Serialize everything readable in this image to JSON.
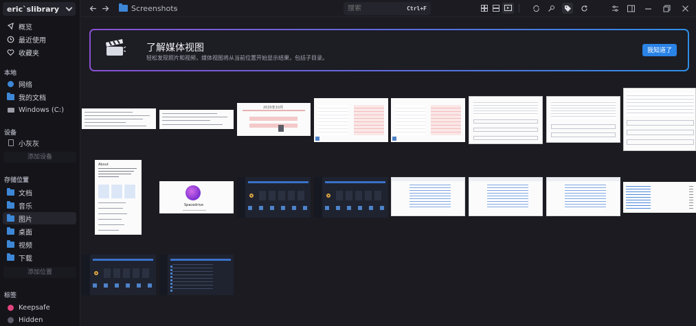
{
  "sidebar": {
    "library_name": "eric`slibrary",
    "nav": [
      {
        "label": "概览",
        "icon": "overview-icon"
      },
      {
        "label": "最近使用",
        "icon": "clock-icon"
      },
      {
        "label": "收藏夹",
        "icon": "heart-icon"
      }
    ],
    "local_label": "本地",
    "local_items": [
      {
        "label": "网络",
        "icon": "network-icon"
      },
      {
        "label": "我的文档",
        "icon": "folder-icon"
      },
      {
        "label": "Windows (C:)",
        "icon": "drive-icon"
      }
    ],
    "devices_label": "设备",
    "device_items": [
      {
        "label": "小灰灰",
        "icon": "laptop-icon"
      }
    ],
    "add_device": "添加设备",
    "locations_label": "存储位置",
    "location_items": [
      {
        "label": "文档",
        "icon": "folder-icon"
      },
      {
        "label": "音乐",
        "icon": "folder-icon"
      },
      {
        "label": "图片",
        "icon": "folder-icon",
        "active": true
      },
      {
        "label": "桌面",
        "icon": "folder-icon"
      },
      {
        "label": "视频",
        "icon": "folder-icon"
      },
      {
        "label": "下载",
        "icon": "folder-icon"
      }
    ],
    "add_location": "添加位置",
    "tags_label": "标签",
    "tag_items": [
      {
        "label": "Keepsafe",
        "color": "#e0457b"
      },
      {
        "label": "Hidden",
        "color": "#5a5b66"
      }
    ]
  },
  "topbar": {
    "current_folder": "Screenshots",
    "more": "⋯",
    "search_placeholder": "搜索",
    "search_shortcut": "Ctrl+F"
  },
  "banner": {
    "title": "了解媒体视图",
    "subtitle": "轻松发现照片和视频，媒体视图将从当前位置开始显示结果，包括子目录。",
    "button": "我知道了"
  },
  "thumbnails": {
    "calendar_title": "2020年10月",
    "app_name": "Spacedrive",
    "about_heading": "About"
  },
  "colors": {
    "accent": "#2a83e6",
    "sidebar_bg": "#141419",
    "content_bg": "#1b1b21",
    "keepsafe": "#e0457b"
  }
}
